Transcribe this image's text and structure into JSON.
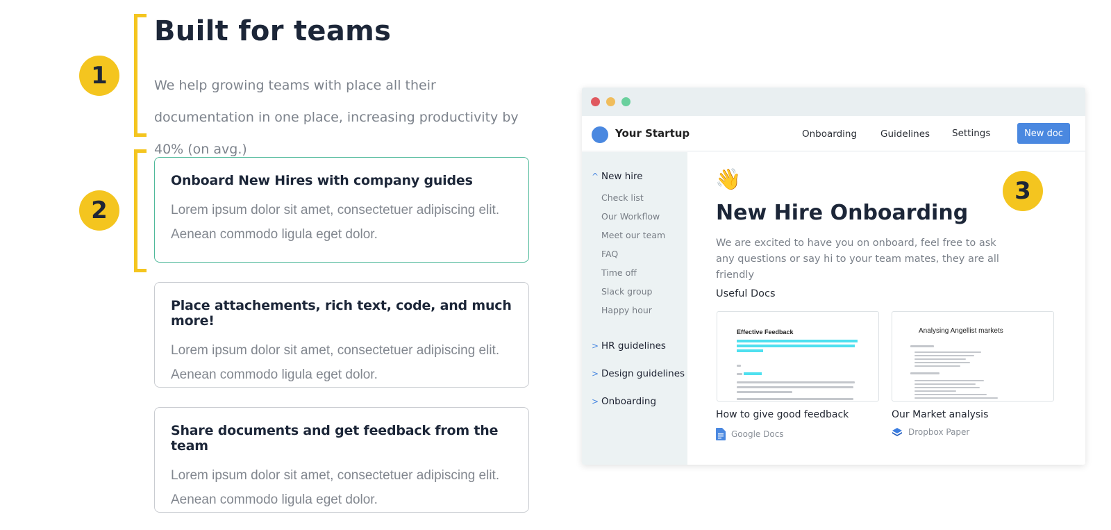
{
  "colors": {
    "accent_yellow": "#f4c51f",
    "active_border": "#4fb99a",
    "brand_blue": "#4a88e0"
  },
  "badges": [
    "1",
    "2",
    "3"
  ],
  "hero": {
    "title": "Built for teams",
    "description": "We help growing teams with place all their documentation in one place, increasing productivity by 40% (on avg.)"
  },
  "features": [
    {
      "title": "Onboard New Hires with company guides",
      "body": "Lorem ipsum dolor sit amet, consectetuer adipiscing elit. Aenean commodo ligula eget dolor.",
      "active": true
    },
    {
      "title": "Place attachements, rich text, code, and much more!",
      "body": "Lorem ipsum dolor sit amet, consectetuer adipiscing elit. Aenean commodo ligula eget dolor.",
      "active": false
    },
    {
      "title": "Share documents and get feedback from the team",
      "body": "Lorem ipsum dolor sit amet, consectetuer adipiscing elit. Aenean commodo ligula eget dolor.",
      "active": false
    }
  ],
  "app": {
    "window_controls": {
      "close": "#e0595f",
      "minimize": "#f0bd5c",
      "maximize": "#6ad09d"
    },
    "brand": "Your Startup",
    "nav": [
      "Onboarding",
      "Guidelines",
      "Settings"
    ],
    "new_doc_label": "New doc",
    "sidebar": {
      "expanded_section": "New hire",
      "expanded_icon": "chevron-up-icon",
      "sub_items": [
        "Check list",
        "Our Workflow",
        "Meet our team",
        "FAQ",
        "Time off",
        "Slack group",
        "Happy hour"
      ],
      "collapsed_sections": [
        "HR guidelines",
        "Design guidelines",
        "Onboarding"
      ],
      "collapsed_icon": "chevron-right-icon"
    },
    "doc": {
      "emoji": "👋",
      "title": "New Hire Onboarding",
      "description": "We are excited to have you on onboard, feel free to ask any questions or say hi to your team mates, they are all friendly",
      "useful_docs_heading": "Useful Docs",
      "cards": [
        {
          "thumb_title": "Effective Feedback",
          "caption": "How to give good feedback",
          "source": "Google Docs",
          "source_icon": "google-docs-icon"
        },
        {
          "thumb_title": "Analysing Angellist markets",
          "caption": "Our Market analysis",
          "source": "Dropbox Paper",
          "source_icon": "dropbox-icon"
        }
      ]
    }
  }
}
